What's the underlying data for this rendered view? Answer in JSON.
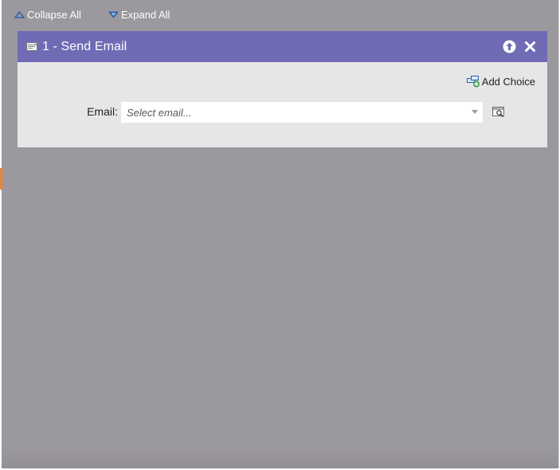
{
  "toolbar": {
    "collapse_label": "Collapse All",
    "expand_label": "Expand All"
  },
  "flow_step": {
    "title": "1 - Send Email",
    "add_choice_label": "Add Choice",
    "email_label": "Email:",
    "email_placeholder": "Select email...",
    "email_value": ""
  },
  "icons": {
    "collapse": "triangle-up-outline-icon",
    "expand": "triangle-down-icon",
    "step": "email-card-icon",
    "move_up": "arrow-up-circle-icon",
    "close": "close-x-icon",
    "add_choice": "add-choice-icon",
    "preview": "preview-magnifier-icon"
  },
  "colors": {
    "header": "#6f6bb5",
    "panel": "#e6e6e6",
    "canvas": "#9b989e",
    "accent": "#e8843a"
  }
}
